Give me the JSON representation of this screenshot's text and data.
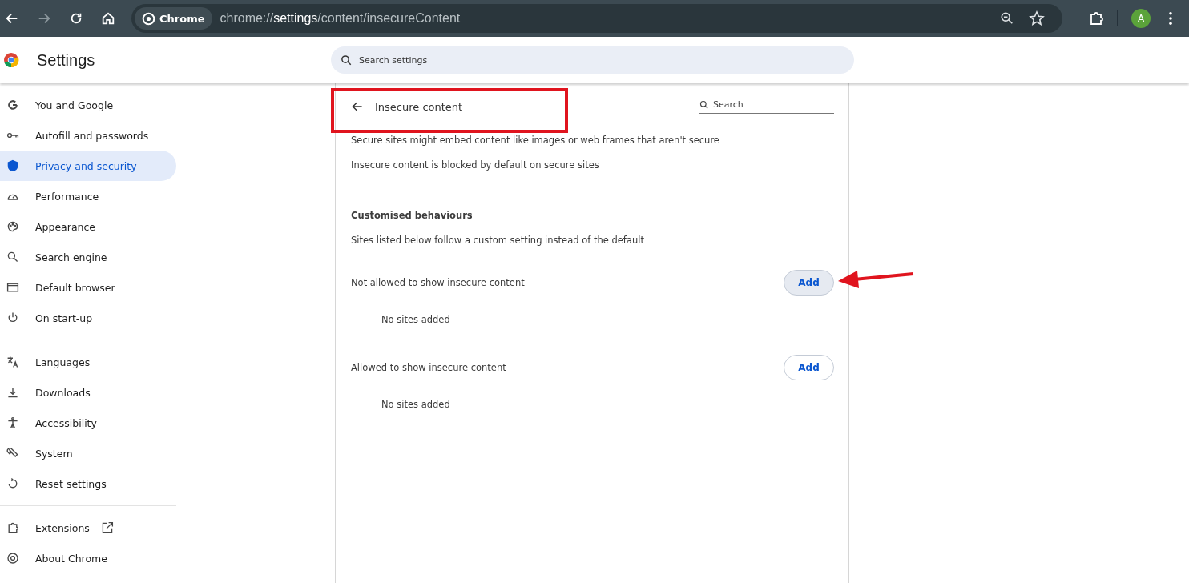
{
  "toolbar": {
    "chip": "Chrome",
    "url": "chrome://**settings**/content/insecureContent",
    "avatar": "A"
  },
  "header": {
    "title": "Settings",
    "search_placeholder": "Search settings"
  },
  "sidebar": {
    "groups": [
      [
        {
          "label": "You and Google",
          "selected": false,
          "external": false
        },
        {
          "label": "Autofill and passwords",
          "selected": false,
          "external": false
        },
        {
          "label": "Privacy and security",
          "selected": true,
          "external": false
        },
        {
          "label": "Performance",
          "selected": false,
          "external": false
        },
        {
          "label": "Appearance",
          "selected": false,
          "external": false
        },
        {
          "label": "Search engine",
          "selected": false,
          "external": false
        },
        {
          "label": "Default browser",
          "selected": false,
          "external": false
        },
        {
          "label": "On start-up",
          "selected": false,
          "external": false
        }
      ],
      [
        {
          "label": "Languages",
          "selected": false,
          "external": false
        },
        {
          "label": "Downloads",
          "selected": false,
          "external": false
        },
        {
          "label": "Accessibility",
          "selected": false,
          "external": false
        },
        {
          "label": "System",
          "selected": false,
          "external": false
        },
        {
          "label": "Reset settings",
          "selected": false,
          "external": false
        }
      ],
      [
        {
          "label": "Extensions",
          "selected": false,
          "external": true
        },
        {
          "label": "About Chrome",
          "selected": false,
          "external": false
        }
      ]
    ]
  },
  "page": {
    "title": "Insecure content",
    "search_placeholder": "Search",
    "description": [
      "Secure sites might embed content like images or web frames that aren't secure",
      "Insecure content is blocked by default on secure sites"
    ],
    "custom_heading": "Customised behaviours",
    "custom_subtitle": "Sites listed below follow a custom setting instead of the default",
    "lists": [
      {
        "label": "Not allowed to show insecure content",
        "button": "Add",
        "hovered": true,
        "empty": "No sites added"
      },
      {
        "label": "Allowed to show insecure content",
        "button": "Add",
        "hovered": false,
        "empty": "No sites added"
      }
    ]
  }
}
